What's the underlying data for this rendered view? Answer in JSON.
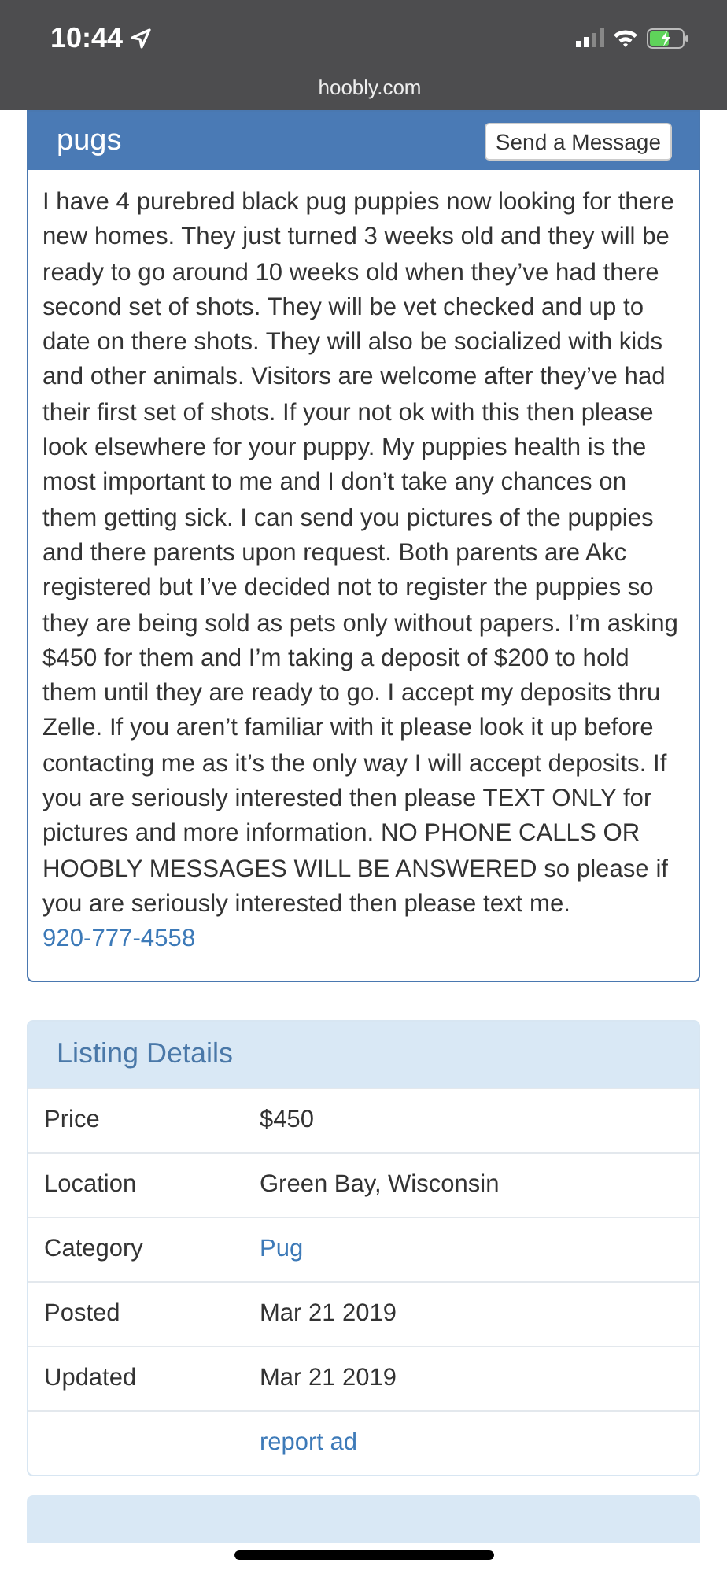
{
  "status_bar": {
    "time": "10:44",
    "url": "hoobly.com"
  },
  "listing": {
    "title": "pugs",
    "message_button": "Send a Message",
    "description": "I have 4 purebred black pug puppies now looking for there new homes. They just turned 3 weeks old and they will be ready to go around 10 weeks old when they’ve had there second set of shots. They will be vet checked and up to date on there shots. They will also be socialized with kids and other animals. Visitors are welcome after they’ve had their first set of shots. If your not ok with this then please look elsewhere for your puppy. My puppies health is the most important to me and I don’t take any chances on them getting sick. I can send you pictures of the puppies and there parents upon request. Both parents are Akc registered but I’ve decided not to register the puppies so they are being sold as pets only without papers. I’m asking $450 for them and I’m taking a deposit of $200 to hold them until they are ready to go. I accept my deposits thru Zelle. If you aren’t familiar with it please look it up before contacting me as it’s the only way I will accept deposits. If you are seriously interested then please TEXT ONLY for pictures and more information. NO PHONE CALLS OR HOOBLY MESSAGES WILL BE ANSWERED so please if you are seriously interested then please text me.",
    "phone": "920-777-4558"
  },
  "details": {
    "title": "Listing Details",
    "rows": [
      {
        "label": "Price",
        "value": "$450",
        "kind": "text"
      },
      {
        "label": "Location",
        "value": "Green Bay, Wisconsin",
        "kind": "text"
      },
      {
        "label": "Category",
        "value": "Pug",
        "kind": "link"
      },
      {
        "label": "Posted",
        "value": "Mar 21 2019",
        "kind": "text"
      },
      {
        "label": "Updated",
        "value": "Mar 21 2019",
        "kind": "text"
      },
      {
        "value": "report ad",
        "kind": "link"
      }
    ]
  }
}
